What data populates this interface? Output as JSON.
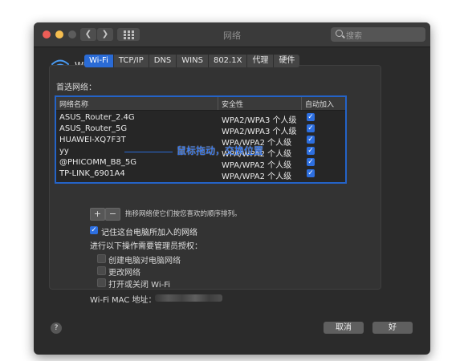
{
  "window": {
    "title": "网络",
    "search_placeholder": "搜索"
  },
  "interface": {
    "label": "Wi-Fi"
  },
  "tabs": [
    {
      "label": "Wi-Fi",
      "active": true
    },
    {
      "label": "TCP/IP"
    },
    {
      "label": "DNS"
    },
    {
      "label": "WINS"
    },
    {
      "label": "802.1X"
    },
    {
      "label": "代理"
    },
    {
      "label": "硬件"
    }
  ],
  "preferred_networks": {
    "label": "首选网络：",
    "columns": {
      "name": "网络名称",
      "security": "安全性",
      "auto_join": "自动加入"
    },
    "rows": [
      {
        "name": "ASUS_Router_2.4G",
        "security": "WPA2/WPA3 个人级",
        "auto_join": true
      },
      {
        "name": "ASUS_Router_5G",
        "security": "WPA2/WPA3 个人级",
        "auto_join": true
      },
      {
        "name": "HUAWEI-XQ7F3T",
        "security": "WPA/WPA2 个人级",
        "auto_join": true
      },
      {
        "name": "yy",
        "security": "WPA/WPA2 个人级",
        "auto_join": true
      },
      {
        "name": "@PHICOMM_B8_5G",
        "security": "WPA/WPA2 个人级",
        "auto_join": true
      },
      {
        "name": "TP-LINK_6901A4",
        "security": "WPA/WPA2 个人级",
        "auto_join": true
      }
    ],
    "annotation": "鼠标拖动，交换位置",
    "add_label": "+",
    "remove_label": "−",
    "hint": "拖移网络使它们按您喜欢的顺序排列。"
  },
  "options": {
    "remember": {
      "label": "记住这台电脑所加入的网络",
      "checked": true
    },
    "admin_heading": "进行以下操作需要管理员授权：",
    "admin_items": [
      {
        "label": "创建电脑对电脑网络",
        "checked": false
      },
      {
        "label": "更改网络",
        "checked": false
      },
      {
        "label": "打开或关闭 Wi-Fi",
        "checked": false
      }
    ]
  },
  "mac": {
    "label": "Wi-Fi MAC 地址："
  },
  "footer": {
    "help": "?",
    "cancel": "取消",
    "ok": "好"
  },
  "colors": {
    "accent": "#2a6bd6",
    "annotation": "#1f6fff",
    "window_bg": "#2b2b2b"
  }
}
